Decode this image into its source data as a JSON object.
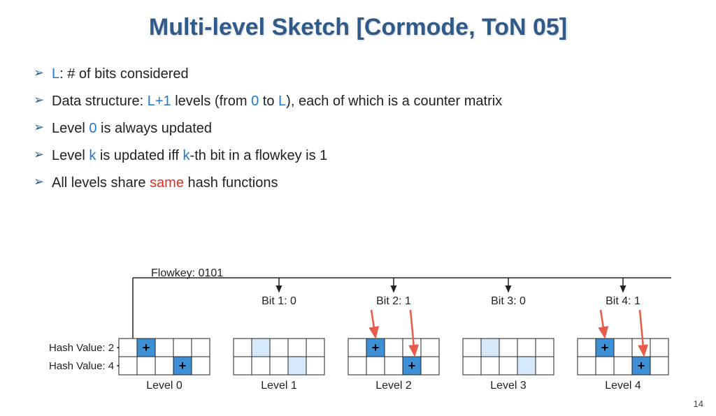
{
  "title": "Multi-level Sketch [Cormode, ToN 05]",
  "bullets": {
    "b1": {
      "L": "L",
      "rest": ": # of bits considered"
    },
    "b2": {
      "p1": "Data structure: ",
      "Lp1": "L+1",
      "p2": " levels (from ",
      "zero": "0",
      "p3": " to ",
      "L2": "L",
      "p4": "), each of which is a counter matrix"
    },
    "b3": {
      "p1": "Level ",
      "zero": "0",
      "p2": " is always updated"
    },
    "b4": {
      "p1": "Level ",
      "k": "k",
      "p2": " is updated iff ",
      "k2": "k",
      "p3": "-th bit in a flowkey is 1"
    },
    "b5": {
      "p1": "All levels share ",
      "same": "same",
      "p2": " hash functions"
    }
  },
  "diagram": {
    "flowkey": "Flowkey: 0101",
    "bits": [
      "Bit 1: 0",
      "Bit 2: 1",
      "Bit 3: 0",
      "Bit 4: 1"
    ],
    "hash_labels": [
      "Hash Value: 2",
      "Hash Value: 4"
    ],
    "level_labels": [
      "Level 0",
      "Level 1",
      "Level 2",
      "Level 3",
      "Level 4"
    ],
    "levels": [
      {
        "cells": [
          [
            0,
            1,
            0,
            0,
            0
          ],
          [
            0,
            0,
            0,
            1,
            0
          ]
        ],
        "update": true,
        "arrows": [
          1,
          3
        ]
      },
      {
        "cells": [
          [
            0,
            2,
            0,
            0,
            0
          ],
          [
            0,
            0,
            0,
            2,
            0
          ]
        ],
        "update": false,
        "arrows": []
      },
      {
        "cells": [
          [
            0,
            1,
            0,
            0,
            0
          ],
          [
            0,
            0,
            0,
            1,
            0
          ]
        ],
        "update": true,
        "arrows": [
          1,
          3
        ]
      },
      {
        "cells": [
          [
            0,
            2,
            0,
            0,
            0
          ],
          [
            0,
            0,
            0,
            2,
            0
          ]
        ],
        "update": false,
        "arrows": []
      },
      {
        "cells": [
          [
            0,
            1,
            0,
            0,
            0
          ],
          [
            0,
            0,
            0,
            1,
            0
          ]
        ],
        "update": true,
        "arrows": [
          1,
          3
        ]
      }
    ]
  },
  "page_number": "14"
}
